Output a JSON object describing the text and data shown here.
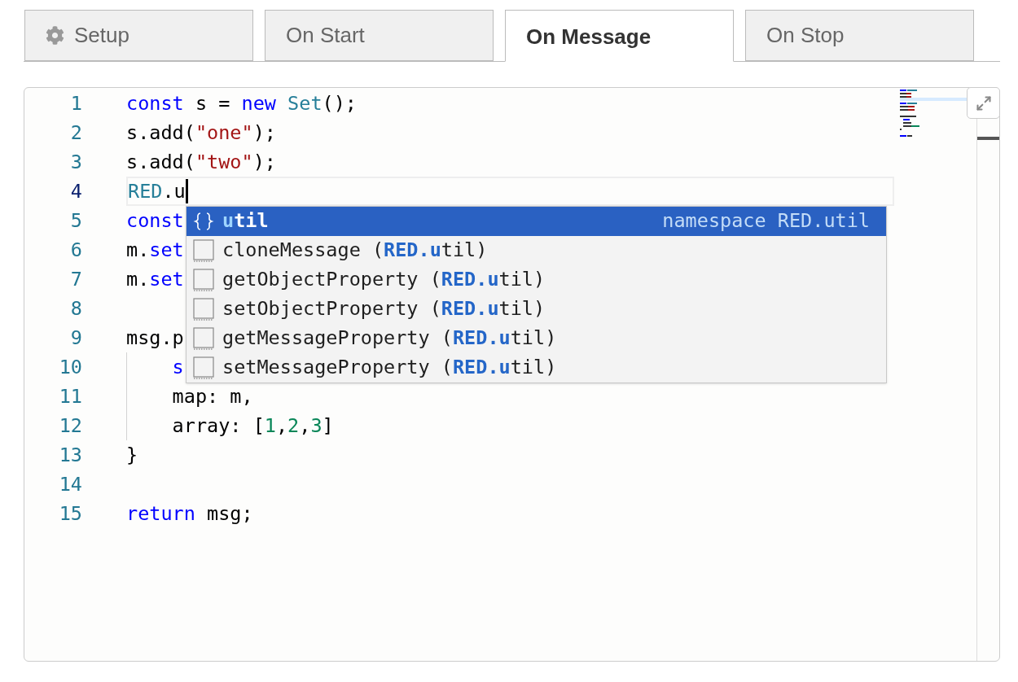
{
  "tabs": [
    {
      "label": "Setup",
      "kind": "settings",
      "selected": false
    },
    {
      "label": "On Start",
      "kind": "plain",
      "selected": false
    },
    {
      "label": "On Message",
      "kind": "plain",
      "selected": true
    },
    {
      "label": "On Stop",
      "kind": "plain",
      "selected": false
    }
  ],
  "editor": {
    "lines": [
      {
        "number": "1",
        "current": false,
        "tokens": [
          {
            "text": "const",
            "kind": "keyword"
          },
          {
            "text": " s = ",
            "kind": "plain"
          },
          {
            "text": "new ",
            "kind": "keyword"
          },
          {
            "text": "Set",
            "kind": "type"
          },
          {
            "text": "();",
            "kind": "plain"
          }
        ]
      },
      {
        "number": "2",
        "current": false,
        "tokens": [
          {
            "text": "s.add(",
            "kind": "plain"
          },
          {
            "text": "\"one\"",
            "kind": "string"
          },
          {
            "text": ");",
            "kind": "plain"
          }
        ]
      },
      {
        "number": "3",
        "current": false,
        "tokens": [
          {
            "text": "s.add(",
            "kind": "plain"
          },
          {
            "text": "\"two\"",
            "kind": "string"
          },
          {
            "text": ");",
            "kind": "plain"
          }
        ]
      },
      {
        "number": "4",
        "current": true,
        "tokens": [
          {
            "text": "RED",
            "kind": "type"
          },
          {
            "text": ".u",
            "kind": "plain"
          }
        ]
      },
      {
        "number": "5",
        "current": false,
        "tokens": [
          {
            "text": "const",
            "kind": "keyword"
          }
        ]
      },
      {
        "number": "6",
        "current": false,
        "tokens": [
          {
            "text": "m.",
            "kind": "plain"
          },
          {
            "text": "set",
            "kind": "keyword"
          }
        ]
      },
      {
        "number": "7",
        "current": false,
        "tokens": [
          {
            "text": "m.",
            "kind": "plain"
          },
          {
            "text": "set",
            "kind": "keyword"
          }
        ]
      },
      {
        "number": "8",
        "current": false
      },
      {
        "number": "9",
        "current": false,
        "tokens": [
          {
            "text": "msg.p",
            "kind": "plain"
          }
        ]
      },
      {
        "number": "10",
        "current": false,
        "tokens": [
          {
            "text": "    s",
            "kind": "keyword"
          }
        ]
      },
      {
        "number": "11",
        "current": false,
        "tokens": [
          {
            "text": "    map: m,",
            "kind": "plain"
          }
        ]
      },
      {
        "number": "12",
        "current": false,
        "tokens": [
          {
            "text": "    array: [",
            "kind": "plain"
          },
          {
            "text": "1",
            "kind": "number"
          },
          {
            "text": ",",
            "kind": "plain"
          },
          {
            "text": "2",
            "kind": "number"
          },
          {
            "text": ",",
            "kind": "plain"
          },
          {
            "text": "3",
            "kind": "number"
          },
          {
            "text": "]",
            "kind": "plain"
          }
        ]
      },
      {
        "number": "13",
        "current": false,
        "tokens": [
          {
            "text": "}",
            "kind": "plain"
          }
        ]
      },
      {
        "number": "14",
        "current": false
      },
      {
        "number": "15",
        "current": false,
        "tokens": [
          {
            "text": "return",
            "kind": "keyword"
          },
          {
            "text": " msg;",
            "kind": "plain"
          }
        ]
      }
    ],
    "suggestions": [
      {
        "kind": "namespace",
        "label": "**u**til",
        "detail": "namespace RED.util",
        "selected": true
      },
      {
        "kind": "property",
        "label": "cloneMessage (**RED.u**til)",
        "selected": false
      },
      {
        "kind": "property",
        "label": "getObjectProperty (**RED.u**til)",
        "selected": false
      },
      {
        "kind": "property",
        "label": "setObjectProperty (**RED.u**til)",
        "selected": false
      },
      {
        "kind": "property",
        "label": "getMessageProperty (**RED.u**til)",
        "selected": false
      },
      {
        "kind": "property",
        "label": "setMessageProperty (**RED.u**til)",
        "selected": false
      }
    ]
  }
}
